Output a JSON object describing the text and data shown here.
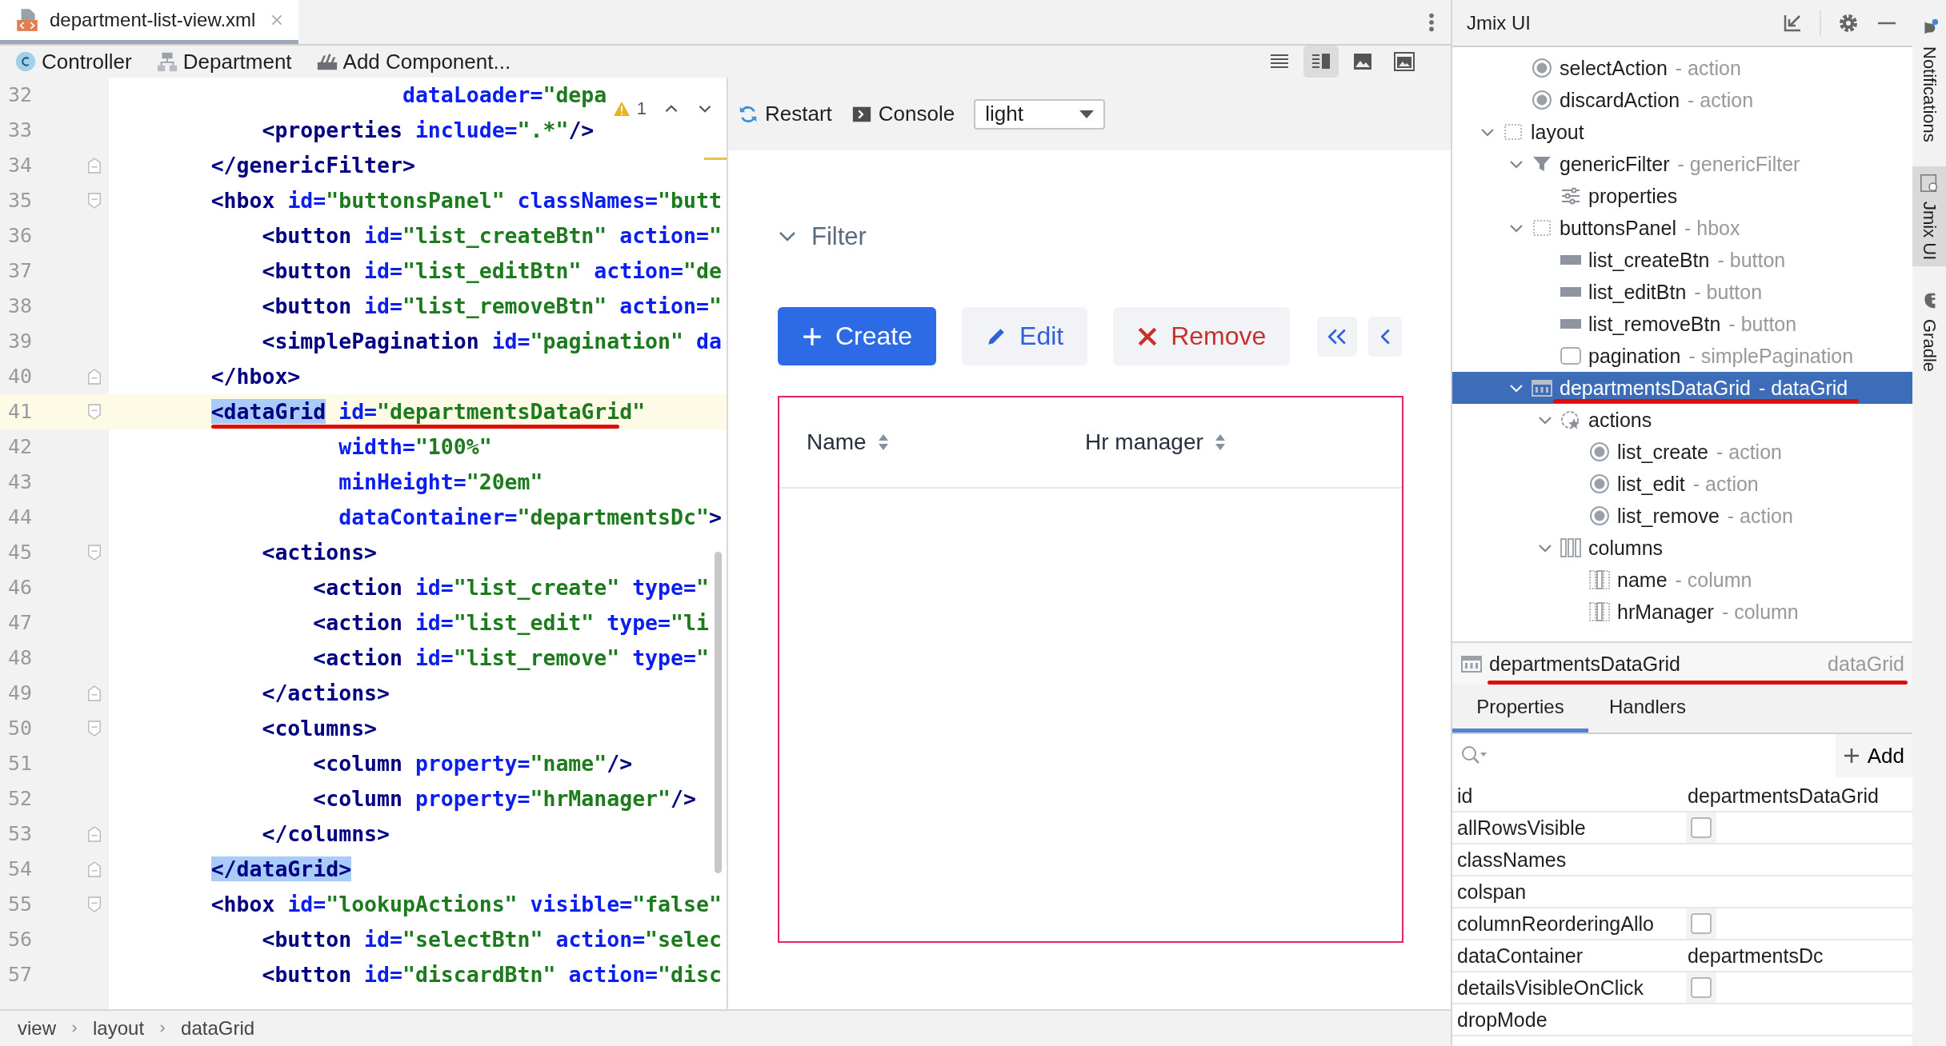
{
  "file_tab": {
    "label": "department-list-view.xml",
    "selected": true
  },
  "toolbar": {
    "items": [
      {
        "kind": "controller",
        "label": "Controller"
      },
      {
        "kind": "entity",
        "label": "Department"
      },
      {
        "kind": "add",
        "label": "Add Component..."
      }
    ],
    "view_modes": [
      {
        "kind": "text",
        "selected": false
      },
      {
        "kind": "split",
        "selected": true
      },
      {
        "kind": "preview",
        "selected": false
      },
      {
        "kind": "framed",
        "selected": false
      }
    ]
  },
  "editor": {
    "inspection": {
      "count": "1"
    },
    "lines": [
      {
        "number": "32",
        "kind": "plain",
        "current": false,
        "tag_highlighted": false,
        "tokens": [
          {
            "kind": "attr",
            "text": "                       dataLoader="
          },
          {
            "kind": "value",
            "text": "\"depa"
          }
        ]
      },
      {
        "number": "33",
        "kind": "plain",
        "current": false,
        "tag_highlighted": false,
        "tokens": [
          {
            "kind": "tag",
            "text": "            <properties"
          },
          {
            "kind": "attr",
            "text": " include="
          },
          {
            "kind": "value",
            "text": "\".*\""
          },
          {
            "kind": "tag",
            "text": "/>"
          }
        ]
      },
      {
        "number": "34",
        "kind": "fold_end",
        "current": false,
        "tag_highlighted": false,
        "tokens": [
          {
            "kind": "tag",
            "text": "        </genericFilter>"
          }
        ]
      },
      {
        "number": "35",
        "kind": "fold_start",
        "current": false,
        "tag_highlighted": false,
        "tokens": [
          {
            "kind": "tag",
            "text": "        <hbox"
          },
          {
            "kind": "attr",
            "text": " id="
          },
          {
            "kind": "value",
            "text": "\"buttonsPanel\""
          },
          {
            "kind": "attr",
            "text": " classNames="
          },
          {
            "kind": "value",
            "text": "\"butt"
          }
        ]
      },
      {
        "number": "36",
        "kind": "plain",
        "current": false,
        "tag_highlighted": false,
        "tokens": [
          {
            "kind": "tag",
            "text": "            <button"
          },
          {
            "kind": "attr",
            "text": " id="
          },
          {
            "kind": "value",
            "text": "\"list_createBtn\""
          },
          {
            "kind": "attr",
            "text": " action="
          },
          {
            "kind": "value",
            "text": "\""
          }
        ]
      },
      {
        "number": "37",
        "kind": "plain",
        "current": false,
        "tag_highlighted": false,
        "tokens": [
          {
            "kind": "tag",
            "text": "            <button"
          },
          {
            "kind": "attr",
            "text": " id="
          },
          {
            "kind": "value",
            "text": "\"list_editBtn\""
          },
          {
            "kind": "attr",
            "text": " action="
          },
          {
            "kind": "value",
            "text": "\"de"
          }
        ]
      },
      {
        "number": "38",
        "kind": "plain",
        "current": false,
        "tag_highlighted": false,
        "tokens": [
          {
            "kind": "tag",
            "text": "            <button"
          },
          {
            "kind": "attr",
            "text": " id="
          },
          {
            "kind": "value",
            "text": "\"list_removeBtn\""
          },
          {
            "kind": "attr",
            "text": " action="
          },
          {
            "kind": "value",
            "text": "\""
          }
        ]
      },
      {
        "number": "39",
        "kind": "plain",
        "current": false,
        "tag_highlighted": false,
        "tokens": [
          {
            "kind": "tag",
            "text": "            <simplePagination"
          },
          {
            "kind": "attr",
            "text": " id="
          },
          {
            "kind": "value",
            "text": "\"pagination\""
          },
          {
            "kind": "attr",
            "text": " da"
          }
        ]
      },
      {
        "number": "40",
        "kind": "fold_end",
        "current": false,
        "tag_highlighted": false,
        "tokens": [
          {
            "kind": "tag",
            "text": "        </hbox>"
          }
        ]
      },
      {
        "number": "41",
        "kind": "fold_start",
        "current": true,
        "tag_highlighted": true,
        "underlined": true,
        "tokens": [
          {
            "kind": "tag",
            "text": "        <dataGrid"
          },
          {
            "kind": "attr",
            "text": " id="
          },
          {
            "kind": "value",
            "text": "\"departmentsDataGrid\""
          }
        ]
      },
      {
        "number": "42",
        "kind": "plain",
        "current": false,
        "tag_highlighted": false,
        "tokens": [
          {
            "kind": "attr",
            "text": "                  width="
          },
          {
            "kind": "value",
            "text": "\"100%\""
          }
        ]
      },
      {
        "number": "43",
        "kind": "plain",
        "current": false,
        "tag_highlighted": false,
        "tokens": [
          {
            "kind": "attr",
            "text": "                  minHeight="
          },
          {
            "kind": "value",
            "text": "\"20em\""
          }
        ]
      },
      {
        "number": "44",
        "kind": "plain",
        "current": false,
        "tag_highlighted": false,
        "tokens": [
          {
            "kind": "attr",
            "text": "                  dataContainer="
          },
          {
            "kind": "value",
            "text": "\"departmentsDc\""
          },
          {
            "kind": "tag",
            "text": ">"
          }
        ]
      },
      {
        "number": "45",
        "kind": "fold_start",
        "current": false,
        "tag_highlighted": false,
        "tokens": [
          {
            "kind": "tag",
            "text": "            <actions>"
          }
        ]
      },
      {
        "number": "46",
        "kind": "plain",
        "current": false,
        "tag_highlighted": false,
        "tokens": [
          {
            "kind": "tag",
            "text": "                <action"
          },
          {
            "kind": "attr",
            "text": " id="
          },
          {
            "kind": "value",
            "text": "\"list_create\""
          },
          {
            "kind": "attr",
            "text": " type="
          },
          {
            "kind": "value",
            "text": "\""
          }
        ]
      },
      {
        "number": "47",
        "kind": "plain",
        "current": false,
        "tag_highlighted": false,
        "tokens": [
          {
            "kind": "tag",
            "text": "                <action"
          },
          {
            "kind": "attr",
            "text": " id="
          },
          {
            "kind": "value",
            "text": "\"list_edit\""
          },
          {
            "kind": "attr",
            "text": " type="
          },
          {
            "kind": "value",
            "text": "\"li"
          }
        ]
      },
      {
        "number": "48",
        "kind": "plain",
        "current": false,
        "tag_highlighted": false,
        "tokens": [
          {
            "kind": "tag",
            "text": "                <action"
          },
          {
            "kind": "attr",
            "text": " id="
          },
          {
            "kind": "value",
            "text": "\"list_remove\""
          },
          {
            "kind": "attr",
            "text": " type="
          },
          {
            "kind": "value",
            "text": "\""
          }
        ]
      },
      {
        "number": "49",
        "kind": "fold_end",
        "current": false,
        "tag_highlighted": false,
        "tokens": [
          {
            "kind": "tag",
            "text": "            </actions>"
          }
        ]
      },
      {
        "number": "50",
        "kind": "fold_start",
        "current": false,
        "tag_highlighted": false,
        "tokens": [
          {
            "kind": "tag",
            "text": "            <columns>"
          }
        ]
      },
      {
        "number": "51",
        "kind": "plain",
        "current": false,
        "tag_highlighted": false,
        "tokens": [
          {
            "kind": "tag",
            "text": "                <column"
          },
          {
            "kind": "attr",
            "text": " property="
          },
          {
            "kind": "value",
            "text": "\"name\""
          },
          {
            "kind": "tag",
            "text": "/>"
          }
        ]
      },
      {
        "number": "52",
        "kind": "plain",
        "current": false,
        "tag_highlighted": false,
        "tokens": [
          {
            "kind": "tag",
            "text": "                <column"
          },
          {
            "kind": "attr",
            "text": " property="
          },
          {
            "kind": "value",
            "text": "\"hrManager\""
          },
          {
            "kind": "tag",
            "text": "/>"
          }
        ]
      },
      {
        "number": "53",
        "kind": "fold_end",
        "current": false,
        "tag_highlighted": false,
        "tokens": [
          {
            "kind": "tag",
            "text": "            </columns>"
          }
        ]
      },
      {
        "number": "54",
        "kind": "fold_end",
        "current": false,
        "tag_highlighted": true,
        "tokens": [
          {
            "kind": "tag",
            "text": "        </dataGrid>"
          }
        ]
      },
      {
        "number": "55",
        "kind": "fold_start",
        "current": false,
        "tag_highlighted": false,
        "tokens": [
          {
            "kind": "tag",
            "text": "        <hbox"
          },
          {
            "kind": "attr",
            "text": " id="
          },
          {
            "kind": "value",
            "text": "\"lookupActions\""
          },
          {
            "kind": "attr",
            "text": " visible="
          },
          {
            "kind": "value",
            "text": "\"false\""
          }
        ]
      },
      {
        "number": "56",
        "kind": "plain",
        "current": false,
        "tag_highlighted": false,
        "tokens": [
          {
            "kind": "tag",
            "text": "            <button"
          },
          {
            "kind": "attr",
            "text": " id="
          },
          {
            "kind": "value",
            "text": "\"selectBtn\""
          },
          {
            "kind": "attr",
            "text": " action="
          },
          {
            "kind": "value",
            "text": "\"selec"
          }
        ]
      },
      {
        "number": "57",
        "kind": "plain",
        "current": false,
        "tag_highlighted": false,
        "tokens": [
          {
            "kind": "tag",
            "text": "            <button"
          },
          {
            "kind": "attr",
            "text": " id="
          },
          {
            "kind": "value",
            "text": "\"discardBtn\""
          },
          {
            "kind": "attr",
            "text": " action="
          },
          {
            "kind": "value",
            "text": "\"disc"
          }
        ]
      }
    ]
  },
  "breadcrumbs": [
    "view",
    "layout",
    "dataGrid"
  ],
  "preview": {
    "toolbar": {
      "restart": "Restart",
      "console": "Console",
      "theme": "light"
    },
    "filter": {
      "label": "Filter",
      "expanded": true
    },
    "buttons": [
      {
        "kind": "create",
        "label": "Create"
      },
      {
        "kind": "edit",
        "label": "Edit"
      },
      {
        "kind": "remove",
        "label": "Remove"
      },
      {
        "kind": "first"
      },
      {
        "kind": "previous"
      }
    ],
    "grid": {
      "selected": true,
      "columns": [
        {
          "label": "Name"
        },
        {
          "label": "Hr manager"
        }
      ]
    }
  },
  "jmix_panel": {
    "title": "Jmix UI",
    "tree": [
      {
        "children": [
          {
            "label": "selectAction",
            "type": "- action",
            "kind": "action",
            "selected": false
          },
          {
            "label": "discardAction",
            "type": "- action",
            "kind": "action",
            "selected": false
          }
        ]
      },
      {
        "label": "layout",
        "kind": "layout",
        "expanded": true,
        "selected": false,
        "children": [
          {
            "label": "genericFilter",
            "type": "- genericFilter",
            "kind": "filter",
            "expanded": true,
            "selected": false,
            "children": [
              {
                "label": "properties",
                "kind": "properties",
                "selected": false
              }
            ]
          },
          {
            "label": "buttonsPanel",
            "type": "- hbox",
            "kind": "hbox",
            "expanded": true,
            "selected": false,
            "children": [
              {
                "label": "list_createBtn",
                "type": "- button",
                "kind": "button",
                "selected": false
              },
              {
                "label": "list_editBtn",
                "type": "- button",
                "kind": "button",
                "selected": false
              },
              {
                "label": "list_removeBtn",
                "type": "- button",
                "kind": "button",
                "selected": false
              },
              {
                "label": "pagination",
                "type": "- simplePagination",
                "kind": "pagination",
                "selected": false
              }
            ]
          },
          {
            "label": "departmentsDataGrid",
            "type": "- dataGrid",
            "kind": "datagrid",
            "expanded": true,
            "selected": true,
            "underlined": true,
            "children": [
              {
                "label": "actions",
                "kind": "actions",
                "expanded": true,
                "selected": false,
                "children": [
                  {
                    "label": "list_create",
                    "type": "- action",
                    "kind": "action",
                    "selected": false
                  },
                  {
                    "label": "list_edit",
                    "type": "- action",
                    "kind": "action",
                    "selected": false
                  },
                  {
                    "label": "list_remove",
                    "type": "- action",
                    "kind": "action",
                    "selected": false
                  }
                ]
              },
              {
                "label": "columns",
                "kind": "columns",
                "expanded": true,
                "selected": false,
                "children": [
                  {
                    "label": "name",
                    "type": "- column",
                    "kind": "column",
                    "selected": false
                  },
                  {
                    "label": "hrManager",
                    "type": "- column",
                    "kind": "column",
                    "selected": false
                  }
                ]
              }
            ]
          }
        ]
      }
    ],
    "details": {
      "name": "departmentsDataGrid",
      "type": "dataGrid",
      "underlined": true,
      "tabs": [
        {
          "label": "Properties",
          "selected": true
        },
        {
          "label": "Handlers",
          "selected": false
        }
      ],
      "add_label": "Add",
      "properties": [
        {
          "name": "id",
          "kind": "text",
          "value": "departmentsDataGrid"
        },
        {
          "name": "allRowsVisible",
          "kind": "checkbox",
          "checked": false
        },
        {
          "name": "classNames",
          "kind": "text"
        },
        {
          "name": "colspan",
          "kind": "text"
        },
        {
          "name": "columnReorderingAllo",
          "kind": "checkbox",
          "checked": false
        },
        {
          "name": "dataContainer",
          "kind": "text",
          "value": "departmentsDc"
        },
        {
          "name": "detailsVisibleOnClick",
          "kind": "checkbox",
          "checked": false
        },
        {
          "name": "dropMode",
          "kind": "text"
        }
      ]
    }
  },
  "side_tabs": [
    {
      "kind": "notifications",
      "label": "Notifications",
      "selected": false,
      "badge": true
    },
    {
      "kind": "jmix",
      "label": "Jmix UI",
      "selected": true
    },
    {
      "kind": "gradle",
      "label": "Gradle",
      "selected": false
    }
  ]
}
